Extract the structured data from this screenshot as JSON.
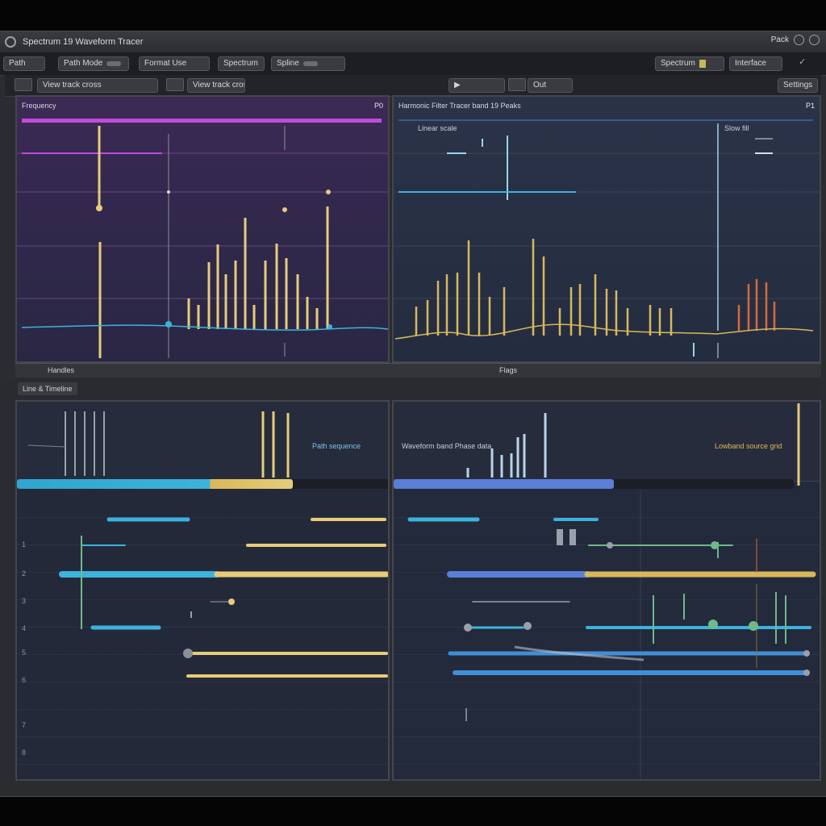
{
  "titlebar": {
    "title": "Spectrum 19 Waveform Tracer",
    "right_label": "Pack"
  },
  "toolbar": {
    "items": [
      "Path",
      "Path Mode",
      "Format Use",
      "Spectrum",
      "Spline",
      "Spectrum",
      "Interface"
    ],
    "help_glyph": "✓"
  },
  "toolbar2": {
    "left_label": "View track cross",
    "right_label": "Settings",
    "center_label": "Out"
  },
  "panels": {
    "top_left": {
      "title": "Frequency",
      "tag": "P0"
    },
    "top_right": {
      "title": "Harmonic Filter Tracer band 19 Peaks",
      "tag": "P1",
      "legend_a": "Linear scale",
      "legend_b": "Slow fill"
    }
  },
  "midbar": {
    "label_left": "Handles",
    "label_right": "Flags"
  },
  "section_tab": {
    "label": "Line & Timeline"
  },
  "bottom_left": {
    "legend": "Path sequence",
    "progress": 0.74,
    "rows": [
      "1",
      "2",
      "3",
      "4",
      "5",
      "6",
      "7",
      "8"
    ]
  },
  "bottom_right": {
    "legend_left": "Waveform band Phase data",
    "legend_right": "Lowband source grid",
    "progress": 0.55
  },
  "colors": {
    "magenta": "#c04cd8",
    "cyan": "#3cb3dc",
    "gold": "#d8b85a",
    "blue": "#5a7fd8",
    "green": "#6fb98a"
  }
}
